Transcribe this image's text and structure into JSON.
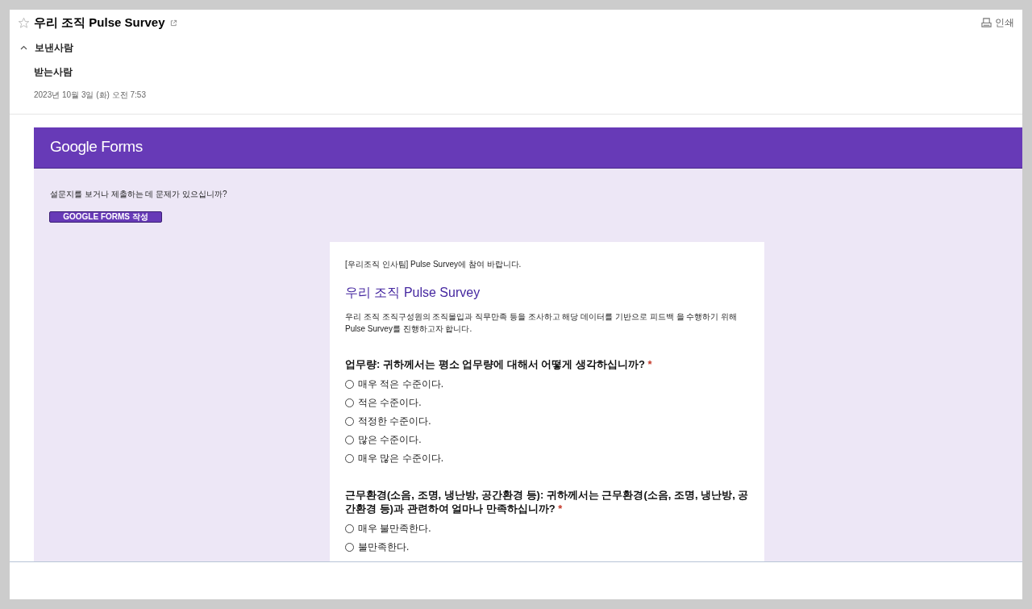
{
  "email": {
    "title": "우리 조직 Pulse Survey",
    "starred": false,
    "print_label": "인쇄",
    "sender_label": "보낸사람",
    "recipient_label": "받는사람",
    "date": "2023년 10월 3일 (화) 오전 7:53"
  },
  "forms_banner": {
    "logo_text": "Google Forms",
    "notice": "설문지를 보거나 제출하는 데 문제가 있으십니까?",
    "button": "GOOGLE FORMS 작성"
  },
  "form": {
    "intro": "[우리조직 인사팀] Pulse Survey에 참여 바랍니다.",
    "title": "우리 조직 Pulse Survey",
    "description": "우리 조직 조직구성원의 조직몰입과 직무만족 등을 조사하고 해당 데이터를 기반으로 피드백 을 수행하기 위해 Pulse Survey를 진행하고자 합니다.",
    "questions": [
      {
        "text": "업무량: 귀하께서는 평소 업무량에 대해서 어떻게 생각하십니까?",
        "required_mark": "*",
        "options": [
          {
            "label": "매우 적은 수준이다.",
            "selected": false
          },
          {
            "label": "적은 수준이다.",
            "selected": false
          },
          {
            "label": "적정한 수준이다.",
            "selected": false
          },
          {
            "label": "많은 수준이다.",
            "selected": false
          },
          {
            "label": "매우 많은 수준이다.",
            "selected": false
          }
        ]
      },
      {
        "text": "근무환경(소음, 조명, 냉난방, 공간환경 등): 귀하께서는 근무환경(소음, 조명, 냉난방, 공간환경 등)과 관련하여 얼마나 만족하십니까?",
        "required_mark": "*",
        "options": [
          {
            "label": "매우 불만족한다.",
            "selected": false
          },
          {
            "label": "불만족한다.",
            "selected": false
          }
        ]
      }
    ]
  }
}
